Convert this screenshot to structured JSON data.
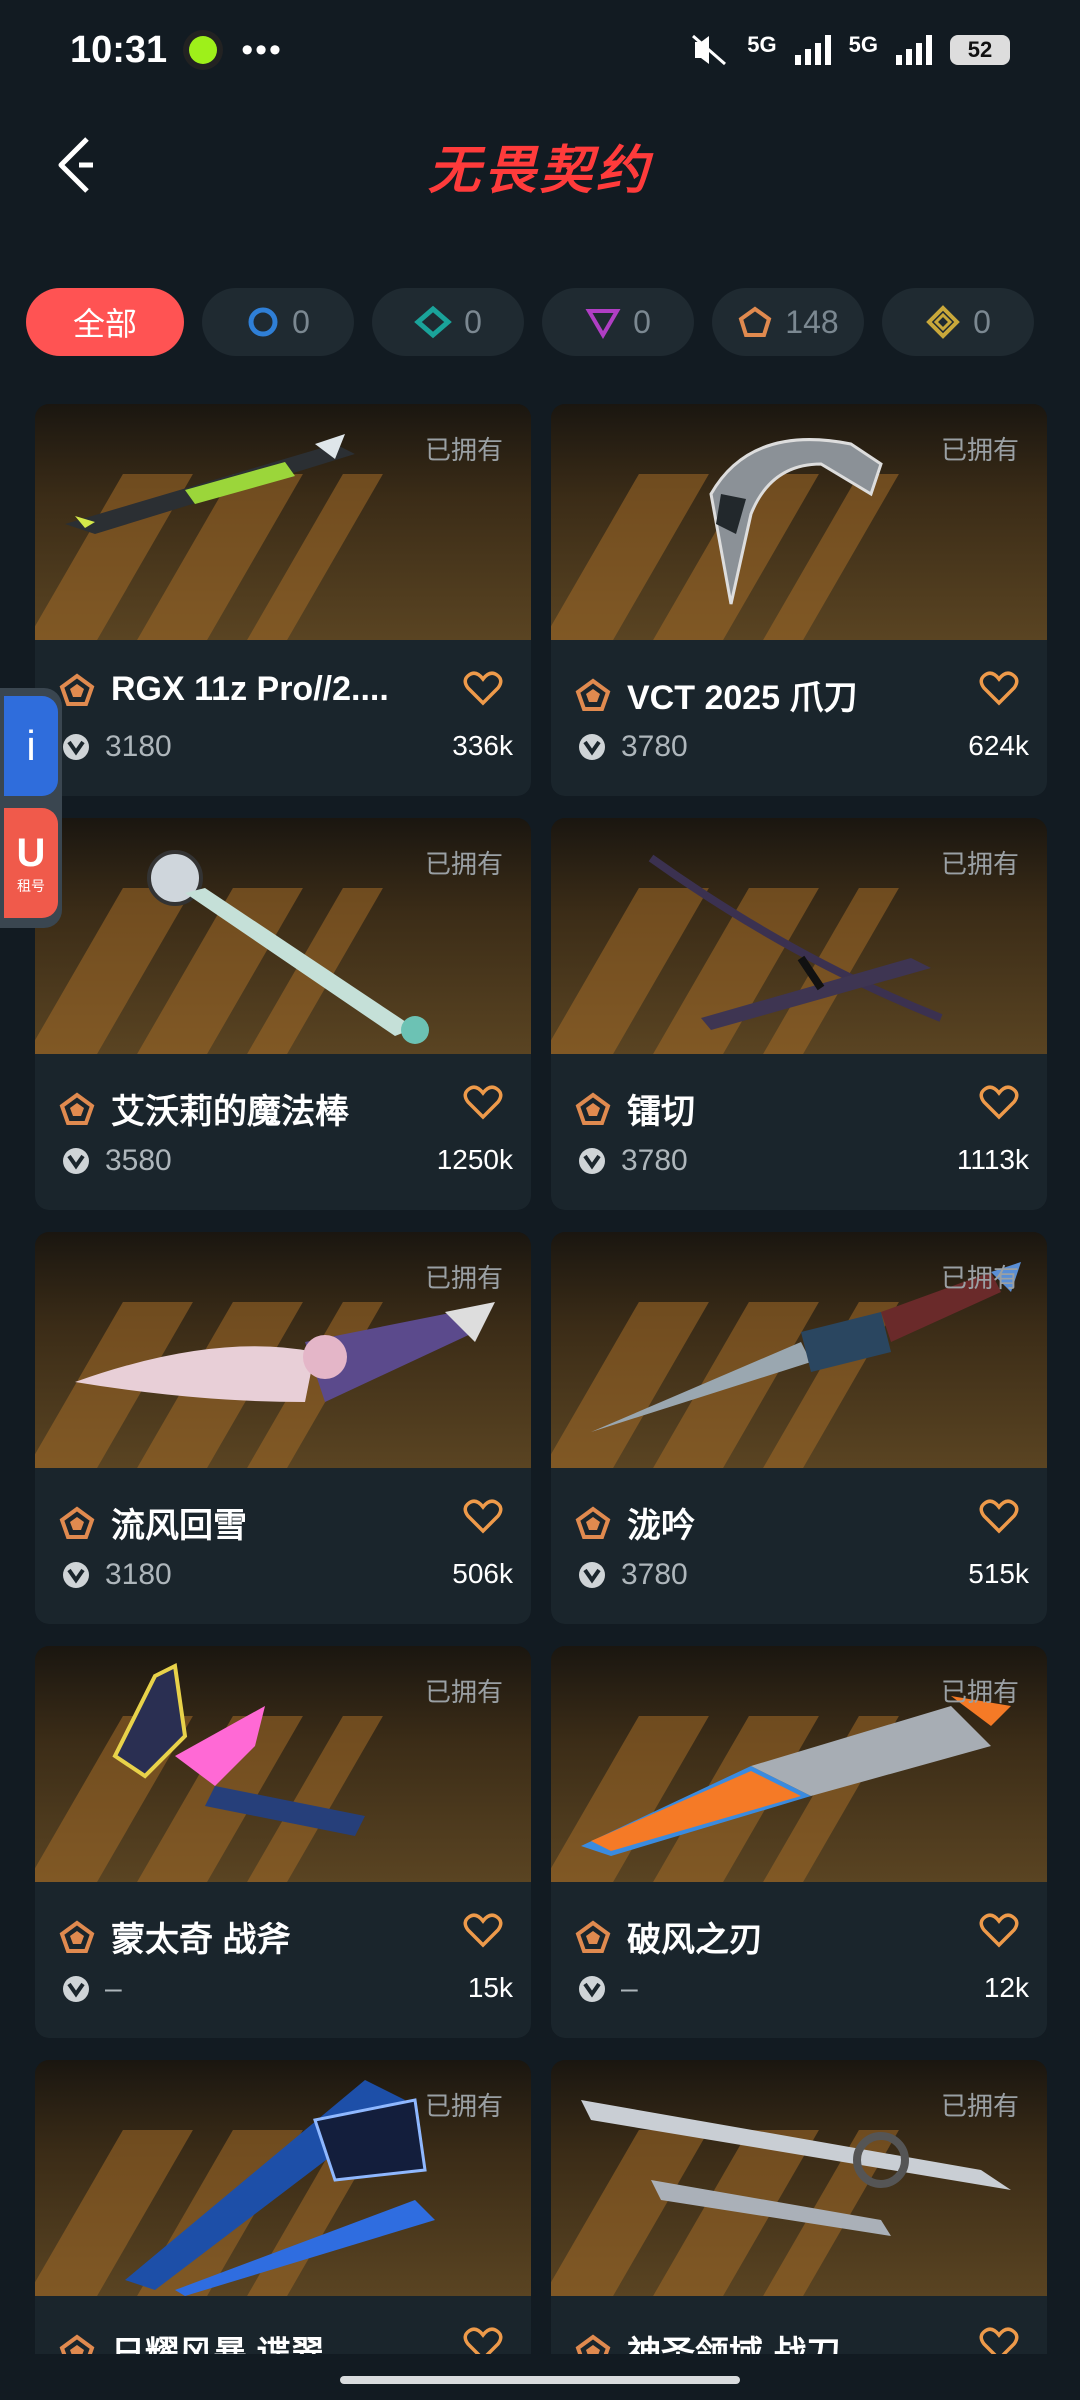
{
  "status_bar": {
    "time": "10:31",
    "dots": "•••",
    "net1": "5G",
    "net2": "5G",
    "battery": "52"
  },
  "header": {
    "title": "无畏契约"
  },
  "filters": [
    {
      "label": "全部",
      "active": true
    },
    {
      "icon": "circle-tier-icon",
      "color": "#2f7fd6",
      "count": "0"
    },
    {
      "icon": "diamond-tier-icon",
      "color": "#1aa39a",
      "count": "0"
    },
    {
      "icon": "triangle-tier-icon",
      "color": "#b03ec4",
      "count": "0"
    },
    {
      "icon": "pentagon-tier-icon",
      "color": "#e08a4f",
      "count": "148"
    },
    {
      "icon": "rhombus-tier-icon",
      "color": "#c9a83a",
      "count": "0"
    }
  ],
  "owned_label": "已拥有",
  "items": [
    {
      "name": "RGX 11z Pro//2....",
      "price": "3180",
      "count": "336k"
    },
    {
      "name": "VCT 2025 爪刀",
      "price": "3780",
      "count": "624k"
    },
    {
      "name": "艾沃莉的魔法棒",
      "price": "3580",
      "count": "1250k"
    },
    {
      "name": "镭切",
      "price": "3780",
      "count": "1113k"
    },
    {
      "name": "流风回雪",
      "price": "3180",
      "count": "506k"
    },
    {
      "name": "泷吟",
      "price": "3780",
      "count": "515k"
    },
    {
      "name": "蒙太奇 战斧",
      "price": "–",
      "count": "15k"
    },
    {
      "name": "破风之刃",
      "price": "–",
      "count": "12k"
    },
    {
      "name": "日耀风暴 谍翠",
      "price": "",
      "count": ""
    },
    {
      "name": "神圣领域 战刀",
      "price": "",
      "count": ""
    }
  ],
  "side_widget": {
    "top_glyph": "i",
    "bottom_glyph": "U",
    "bottom_caption": "租号"
  },
  "colors": {
    "accent": "#ff3b3b",
    "chip_active": "#ff5353",
    "tier_orange": "#e08a4f",
    "background": "#121b22"
  }
}
